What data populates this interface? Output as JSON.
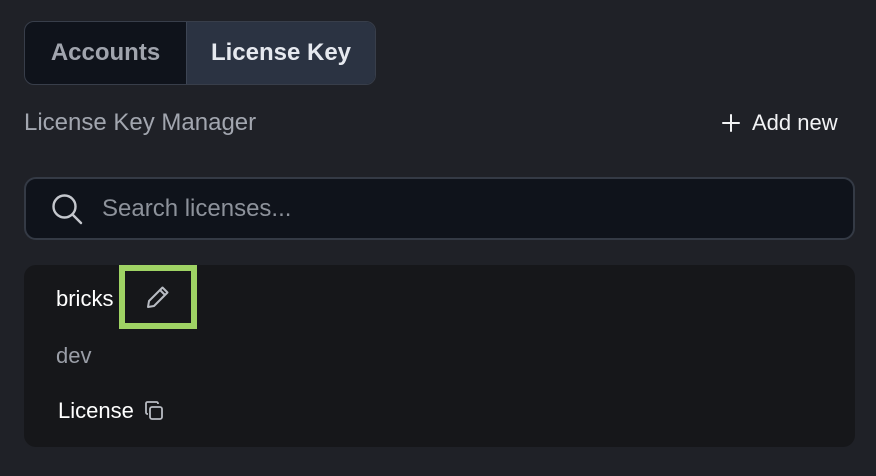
{
  "tabs": [
    {
      "label": "Accounts",
      "active": false
    },
    {
      "label": "License Key",
      "active": true
    }
  ],
  "section": {
    "title": "License Key Manager",
    "add_new_label": "Add new"
  },
  "search": {
    "placeholder": "Search licenses...",
    "value": ""
  },
  "license_item": {
    "name": "bricks",
    "environment": "dev",
    "license_label": "License",
    "icons": {
      "edit": "pencil-icon",
      "copy": "copy-icon"
    }
  },
  "colors": {
    "background": "#1f2127",
    "highlight": "#9fd364",
    "active_tab": "#2b3342"
  }
}
